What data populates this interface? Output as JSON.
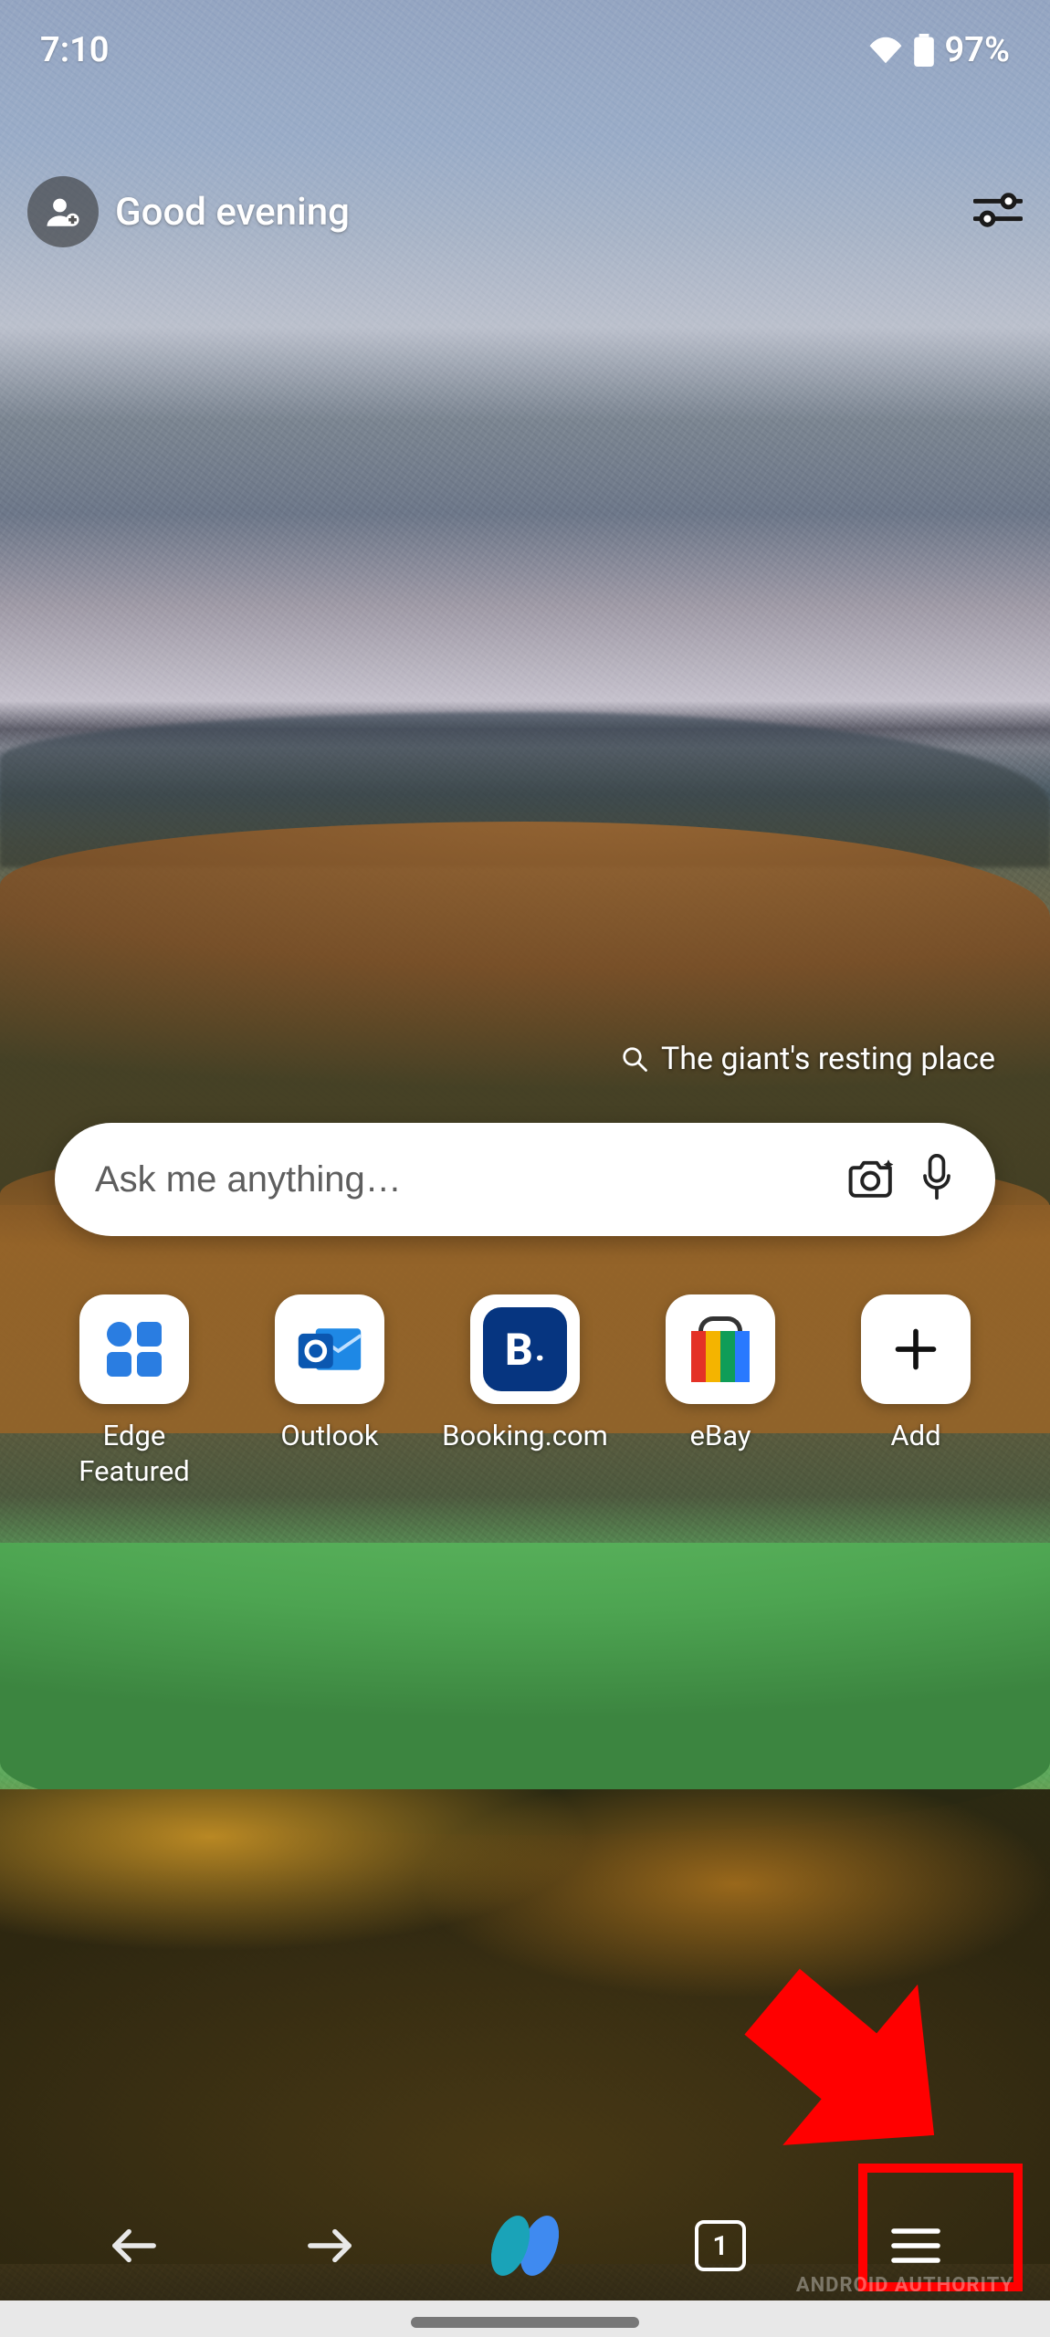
{
  "status": {
    "time": "7:10",
    "battery_pct": "97%"
  },
  "header": {
    "greeting": "Good evening"
  },
  "wallpaper_caption": "The giant's resting place",
  "search": {
    "placeholder": "Ask me anything…"
  },
  "quick_access": [
    {
      "label": "Edge Featured",
      "icon": "edge-featured-icon"
    },
    {
      "label": "Outlook",
      "icon": "outlook-icon"
    },
    {
      "label": "Booking.com",
      "icon": "booking-icon"
    },
    {
      "label": "eBay",
      "icon": "ebay-icon"
    },
    {
      "label": "Add",
      "icon": "plus-icon"
    }
  ],
  "bottom_bar": {
    "tab_count": "1"
  },
  "watermark": "ANDROID AUTHORITY",
  "colors": {
    "callout": "#ff0000",
    "search_bg": "#ffffff",
    "booking_bg": "#063580"
  }
}
